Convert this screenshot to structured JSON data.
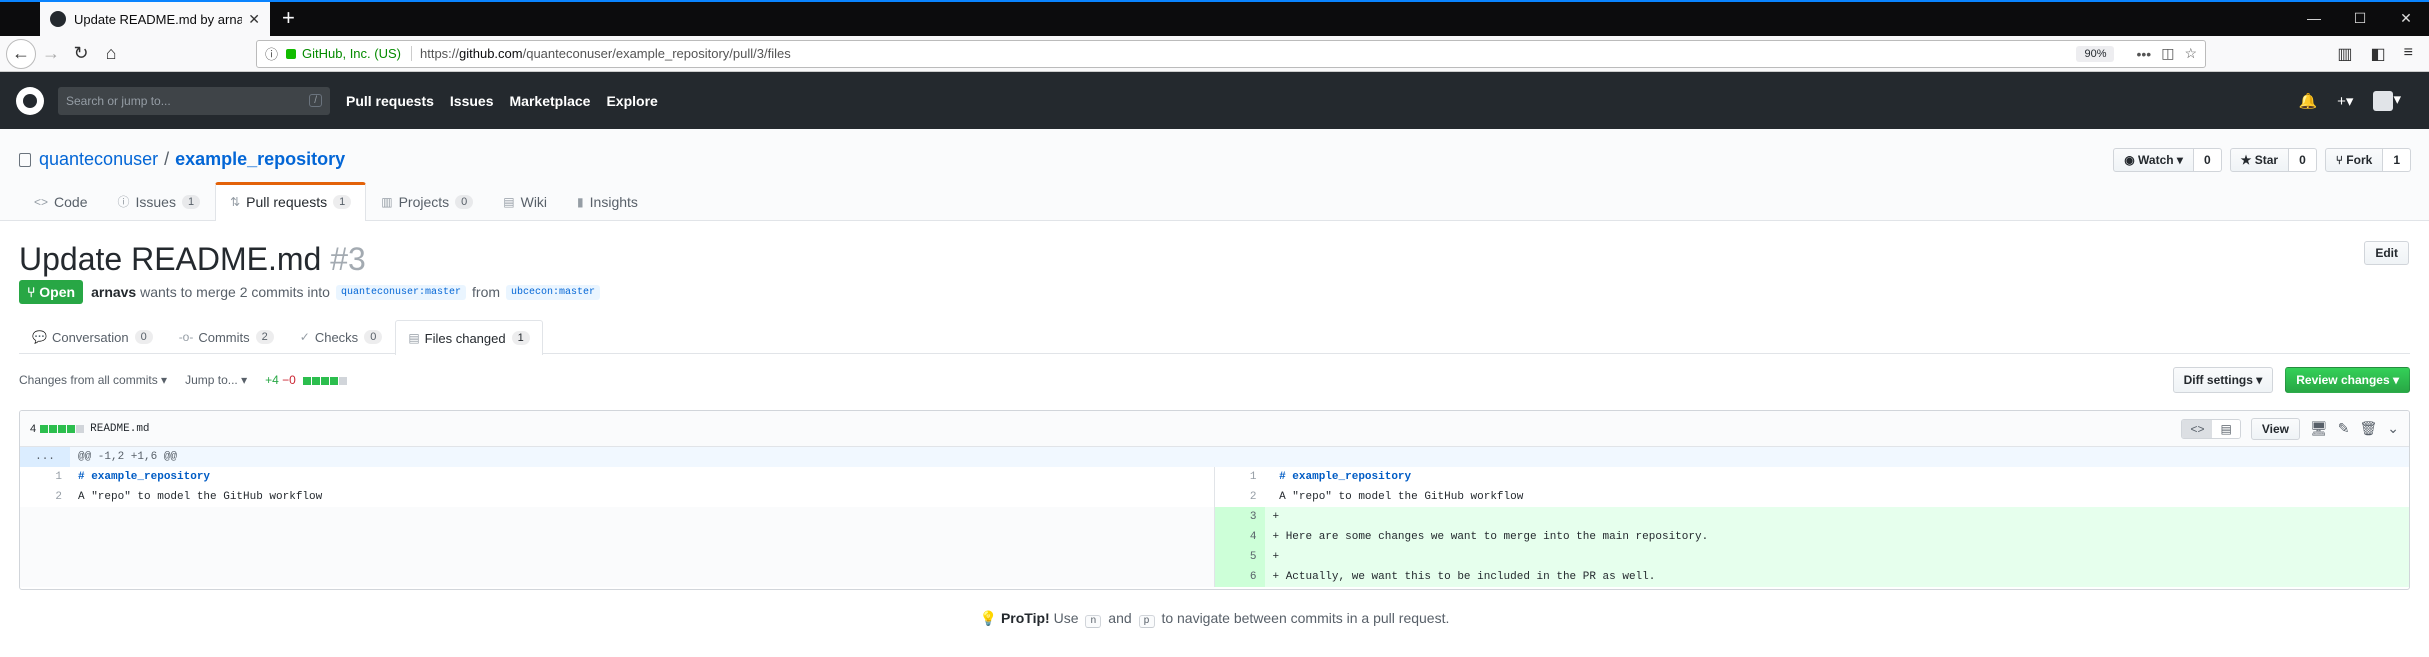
{
  "browser": {
    "tab_title": "Update README.md by arnavs",
    "url_org": "GitHub, Inc. (US)",
    "url_prefix": "https://",
    "url_host": "github.com",
    "url_path": "/quanteconuser/example_repository/pull/3/files",
    "zoom": "90%"
  },
  "gh": {
    "search_placeholder": "Search or jump to...",
    "search_key": "/",
    "nav": [
      "Pull requests",
      "Issues",
      "Marketplace",
      "Explore"
    ]
  },
  "repo": {
    "owner": "quanteconuser",
    "name": "example_repository",
    "watch": {
      "label": "Watch",
      "count": "0"
    },
    "star": {
      "label": "Star",
      "count": "0"
    },
    "fork": {
      "label": "Fork",
      "count": "1"
    },
    "tabs": [
      {
        "label": "Code",
        "count": ""
      },
      {
        "label": "Issues",
        "count": "1"
      },
      {
        "label": "Pull requests",
        "count": "1"
      },
      {
        "label": "Projects",
        "count": "0"
      },
      {
        "label": "Wiki",
        "count": ""
      },
      {
        "label": "Insights",
        "count": ""
      }
    ]
  },
  "pr": {
    "title": "Update README.md",
    "number": "#3",
    "edit": "Edit",
    "state": "Open",
    "author": "arnavs",
    "merge_text": "wants to merge 2 commits into",
    "base": "quanteconuser:master",
    "from": "from",
    "head": "ubcecon:master",
    "tabs": [
      {
        "label": "Conversation",
        "count": "0"
      },
      {
        "label": "Commits",
        "count": "2"
      },
      {
        "label": "Checks",
        "count": "0"
      },
      {
        "label": "Files changed",
        "count": "1"
      }
    ]
  },
  "toolbar": {
    "changes_from": "Changes from all commits",
    "jump_to": "Jump to...",
    "additions": "+4",
    "deletions": "−0",
    "diff_settings": "Diff settings",
    "review_changes": "Review changes"
  },
  "file": {
    "changes": "4",
    "name": "README.md",
    "view": "View",
    "hunk_expand": "...",
    "hunk": "@@ -1,2 +1,6 @@",
    "left": [
      {
        "n": "1",
        "text": "# example_repository"
      },
      {
        "n": "2",
        "text": "A \"repo\" to model the GitHub workflow"
      }
    ],
    "right": [
      {
        "n": "1",
        "text": " # example_repository"
      },
      {
        "n": "2",
        "text": " A \"repo\" to model the GitHub workflow"
      },
      {
        "n": "3",
        "text": "+"
      },
      {
        "n": "4",
        "text": "+ Here are some changes we want to merge into the main repository."
      },
      {
        "n": "5",
        "text": "+"
      },
      {
        "n": "6",
        "text": "+ Actually, we want this to be included in the PR as well."
      }
    ]
  },
  "protip": {
    "label": "ProTip!",
    "use": "Use",
    "key1": "n",
    "and": "and",
    "key2": "p",
    "rest": "to navigate between commits in a pull request."
  }
}
